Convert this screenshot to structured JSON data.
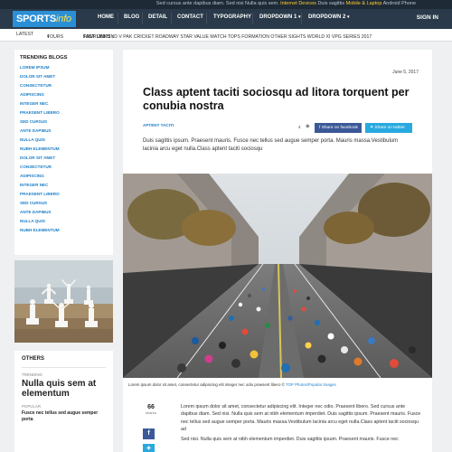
{
  "topbar": {
    "promo_prefix": "Sed cursus ante dapibus diam. Sed nisi Nulla quis sem.",
    "promo_highlight": "Internet Devices",
    "promo_middle": "Duis sagittis",
    "promo_highlight2": "Mobile & Laptop",
    "promo_suffix": "Android Phone"
  },
  "brand": {
    "name": "SPORTS",
    "suffix": "info"
  },
  "nav": {
    "items": [
      "HOME",
      "BLOG",
      "DETAIL",
      "CONTACT",
      "TYPOGRAPHY",
      "DROPDOWN 1",
      "DROPDOWN 2"
    ],
    "signin": "SIGN IN"
  },
  "subbar": {
    "latest": "LATEST",
    "tours": "TOURS",
    "fast_links_label": "FAST LINKS :",
    "fast_links": "TOUR 2017   IND V PAK   CRICKET   ROADWAY   STAR VALUE   MATCH TOPS   FORMATION   OTHER SIGHTS   WORLD XI   VPG   SERIES 2017"
  },
  "sidebar": {
    "title": "TRENDING BLOGS",
    "items": [
      "LOREM IPSUM",
      "DOLOR SIT AMET",
      "CONSECTETUR",
      "ADIPISCING",
      "INTEGER NEC",
      "PRAESENT LIBERO",
      "SED CURSUS",
      "ANTE DAPIBUS",
      "NULLA QUIS",
      "NUBH ELEMENTUM",
      "DOLOR SIT AMET",
      "CONSECTETUR",
      "ADIPISCING",
      "INTEGER NEC",
      "PRAESENT LIBERO",
      "SED CURSUS",
      "ANTE DAPIBUS",
      "NULLA QUIS",
      "NUBH ELEMENTUM"
    ]
  },
  "others": {
    "title": "OTHERS",
    "tag1": "TRENDING",
    "headline": "Nulla quis sem at elementum",
    "tag2": "POPULAR",
    "small": "Fusce nec tellus sed augue semper porta"
  },
  "article": {
    "date": "June 5, 2017",
    "title": "Class aptent taciti sociosqu ad litora torquent per conubia nostra",
    "category": "APTENT TACITI",
    "share_count": "4",
    "share_fb": "Share on facebook",
    "share_tw": "Share on twitter",
    "lead": "Duis sagittis ipsum. Praesent mauris. Fusce nec tellus sed augue semper porta. Mauris massa.Vestibulum lacinia arcu eget nulla.Class aptent taciti sociosqu",
    "caption": "Lorem ipsum dolor sit amet, consectetur adipiscing elit integer nec odio praesent libero ©",
    "caption_source": "TOP Photos/Popular Images",
    "counter_num": "66",
    "counter_label": "shares",
    "body_p1": "Lorem ipsum dolor sit amet, consectetur adipiscing elit. Integer nec odio. Praesent libero. Sed cursus ante dapibus diam. Sed nisi. Nulla quis sem at nibh elementum imperdiet. Duis sagittis ipsum. Praesent mauris. Fusce nec tellus sed augue semper porta. Mauris massa.Vestibulum lacinia arcu eget nulla.Class aptent taciti sociosqu ad",
    "body_p2": "Sed nisi. Nulla quis sem at nibh elementum imperdiet. Duis sagittis ipsum. Praesent mauris. Fusce nec"
  },
  "colors": {
    "accent": "#1d7fc9",
    "nav_bg": "#2a3a4a",
    "facebook": "#3b5998",
    "twitter": "#28a9e0"
  }
}
